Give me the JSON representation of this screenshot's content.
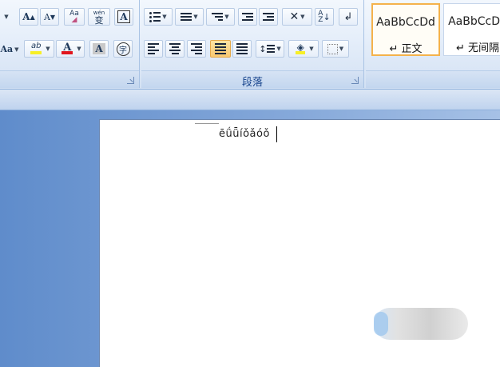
{
  "ribbon": {
    "font_group": {
      "grow_font_label": "A",
      "shrink_font_label": "A",
      "clear_format_label": "Aa",
      "phonetic_label": "wén",
      "phonetic_char": "变",
      "char_border_label": "A",
      "change_case_label": "Aa",
      "highlight_label": "ab",
      "font_color_label": "A",
      "char_shading_label": "A",
      "enclose_char_label": "字",
      "highlight_color": "#f7ef26",
      "font_color": "#e0161d"
    },
    "paragraph_group": {
      "label": "段落"
    },
    "styles_group": {
      "styles": [
        {
          "sample": "AaBbCcDd",
          "name": "↵ 正文",
          "selected": true
        },
        {
          "sample": "AaBbCcDd",
          "name": "↵ 无间隔",
          "selected": false
        }
      ]
    }
  },
  "document": {
    "text": "ēǘǖíǒǎóǒ"
  }
}
